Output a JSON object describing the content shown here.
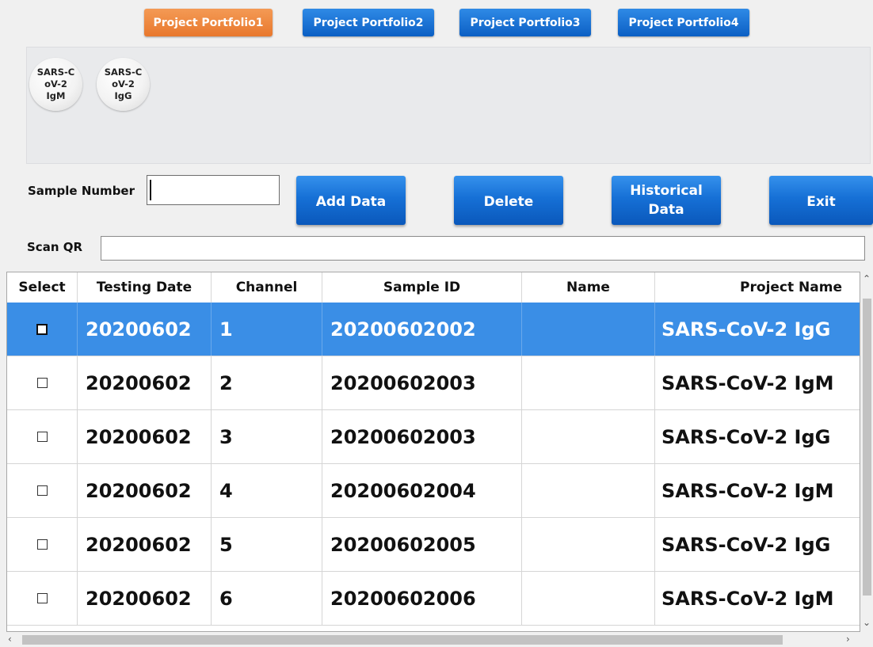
{
  "tabs": [
    {
      "label": "Project Portfolio1",
      "active": true
    },
    {
      "label": "Project Portfolio2",
      "active": false
    },
    {
      "label": "Project Portfolio3",
      "active": false
    },
    {
      "label": "Project Portfolio4",
      "active": false
    }
  ],
  "projects": [
    {
      "label": "SARS-C\noV-2\nIgM"
    },
    {
      "label": "SARS-C\noV-2\nIgG"
    }
  ],
  "form": {
    "sample_number_label": "Sample Number",
    "sample_number_value": "",
    "scan_qr_label": "Scan QR",
    "scan_qr_value": ""
  },
  "buttons": {
    "add_data": "Add Data",
    "delete": "Delete",
    "historical_data": "Historical\nData",
    "exit": "Exit"
  },
  "table": {
    "columns": [
      "Select",
      "Testing Date",
      "Channel",
      "Sample ID",
      "Name",
      "Project Name"
    ],
    "rows": [
      {
        "date": "20200602",
        "channel": "1",
        "sample_id": "20200602002",
        "name": "",
        "project": "SARS-CoV-2 IgG",
        "selected": true
      },
      {
        "date": "20200602",
        "channel": "2",
        "sample_id": "20200602003",
        "name": "",
        "project": "SARS-CoV-2 IgM",
        "selected": false
      },
      {
        "date": "20200602",
        "channel": "3",
        "sample_id": "20200602003",
        "name": "",
        "project": "SARS-CoV-2 IgG",
        "selected": false
      },
      {
        "date": "20200602",
        "channel": "4",
        "sample_id": "20200602004",
        "name": "",
        "project": "SARS-CoV-2 IgM",
        "selected": false
      },
      {
        "date": "20200602",
        "channel": "5",
        "sample_id": "20200602005",
        "name": "",
        "project": "SARS-CoV-2 IgG",
        "selected": false
      },
      {
        "date": "20200602",
        "channel": "6",
        "sample_id": "20200602006",
        "name": "",
        "project": "SARS-CoV-2 IgM",
        "selected": false
      }
    ]
  },
  "colors": {
    "active_tab": "#e8782d",
    "button_blue": "#1670d6",
    "selected_row": "#3a8ee6"
  },
  "icons": {
    "scroll_up": "chevron-up-icon",
    "scroll_down": "chevron-down-icon",
    "scroll_left": "chevron-left-icon",
    "scroll_right": "chevron-right-icon"
  }
}
